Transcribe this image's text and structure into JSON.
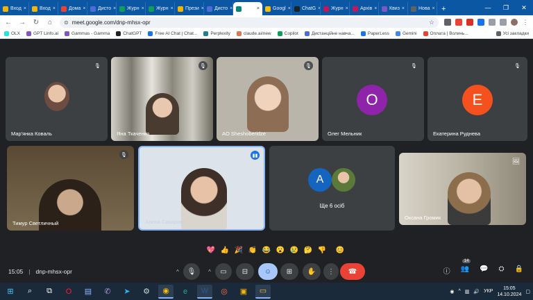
{
  "browser": {
    "tabs": [
      {
        "label": "Вход",
        "color": "#f4b400"
      },
      {
        "label": "Вход",
        "color": "#f4b400"
      },
      {
        "label": "Дома",
        "color": "#ea4335"
      },
      {
        "label": "Дисто",
        "color": "#4f6bd6"
      },
      {
        "label": "Журн",
        "color": "#0f9d58"
      },
      {
        "label": "Журн",
        "color": "#0f9d58"
      },
      {
        "label": "Прези",
        "color": "#f4b400"
      },
      {
        "label": "Дисто",
        "color": "#4f6bd6"
      },
      {
        "label": "",
        "color": "#00897b",
        "active": true
      },
      {
        "label": "Googl",
        "color": "#fbbc04"
      },
      {
        "label": "ChatG",
        "color": "#202124"
      },
      {
        "label": "Журн",
        "color": "#c2185b"
      },
      {
        "label": "Архів",
        "color": "#c2185b"
      },
      {
        "label": "Квиз",
        "color": "#7e57c2"
      },
      {
        "label": "Нова",
        "color": "#5f6368"
      }
    ],
    "new_tab_label": "+",
    "url": "meet.google.com/dnp-mhsx-opr",
    "bookmarks": [
      {
        "label": "OLX",
        "color": "#23e5db"
      },
      {
        "label": "GPT Linfo.ai",
        "color": "#7e57c2"
      },
      {
        "label": "Gammas - Gamma",
        "color": "#7e57c2"
      },
      {
        "label": "ChatGPT",
        "color": "#202124"
      },
      {
        "label": "Free AI Chat | Chat...",
        "color": "#1a73e8"
      },
      {
        "label": "Perplexity",
        "color": "#20808d"
      },
      {
        "label": "claude.ai/new",
        "color": "#d97757"
      },
      {
        "label": "Copilot",
        "color": "#0f9d58"
      },
      {
        "label": "Дистанційне навча...",
        "color": "#4f6bd6"
      },
      {
        "label": "PaperLess",
        "color": "#1a73e8"
      },
      {
        "label": "Gemini",
        "color": "#4285f4"
      },
      {
        "label": "Оплата | Волинь...",
        "color": "#ea4335"
      }
    ],
    "bookmarks_all": "Усі закладки"
  },
  "meet": {
    "participants": [
      {
        "name": "Мар'янка Коваль",
        "kind": "photo",
        "color": "#6d4c41"
      },
      {
        "name": "Яна Ткаченко",
        "kind": "video",
        "color": "#8a8a80"
      },
      {
        "name": "AO Sheshoberidze",
        "kind": "video",
        "color": "#b7b2a6"
      },
      {
        "name": "Олег Мельник",
        "kind": "letter",
        "letter": "O",
        "color": "#8e24aa"
      },
      {
        "name": "Екатерина Руднева",
        "kind": "letter",
        "letter": "E",
        "color": "#f4511e"
      },
      {
        "name": "Тимур Светличный",
        "kind": "video",
        "color": "#6b5a3e"
      },
      {
        "name": "Алена Сахарова",
        "kind": "video",
        "color": "#c9d3dc"
      },
      {
        "name": "Ще 6 осіб",
        "kind": "group",
        "letter": "A",
        "color": "#1565c0"
      },
      {
        "name": "Оксана Громик",
        "kind": "video",
        "color": "#a49a88"
      }
    ],
    "reactions": [
      "💖",
      "👍",
      "🎉",
      "👏",
      "😂",
      "😮",
      "😢",
      "🤔",
      "👎",
      "😊"
    ],
    "time": "15:05",
    "meeting_code": "dnp-mhsx-opr",
    "participant_count": "14"
  },
  "taskbar": {
    "language": "УКР",
    "time": "15:05",
    "date": "14.10.2024"
  }
}
